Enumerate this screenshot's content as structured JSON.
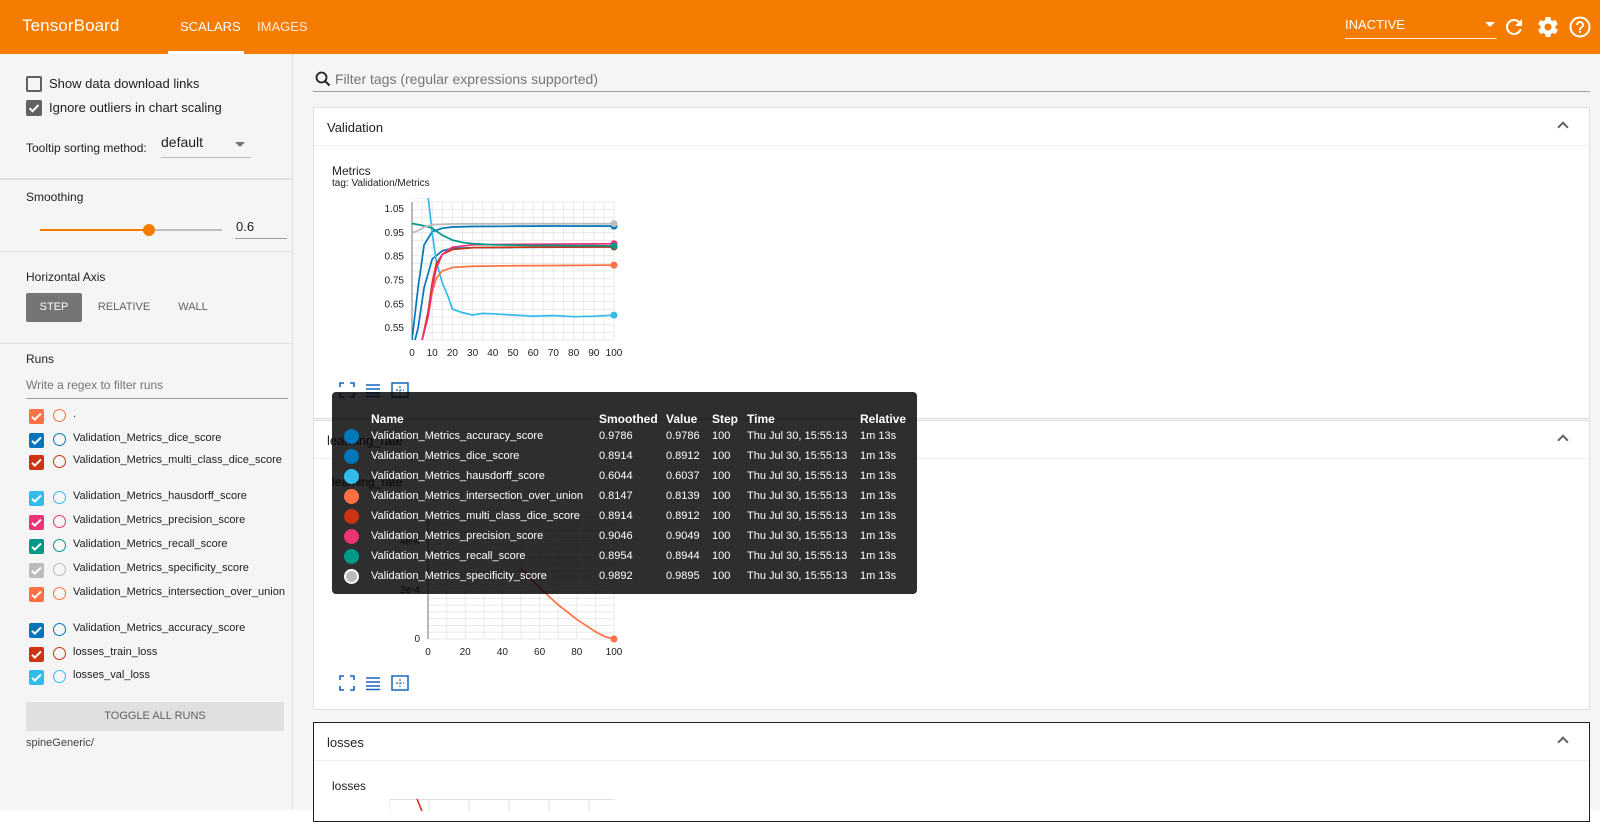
{
  "app": {
    "title": "TensorBoard",
    "tabs": [
      {
        "label": "SCALARS",
        "active": true
      },
      {
        "label": "IMAGES",
        "active": false
      }
    ],
    "run_state": "INACTIVE",
    "accent": "#f57c00"
  },
  "sidebar": {
    "show_download_links": {
      "label": "Show data download links",
      "checked": false
    },
    "ignore_outliers": {
      "label": "Ignore outliers in chart scaling",
      "checked": true
    },
    "tooltip_sorting": {
      "label": "Tooltip sorting method:",
      "value": "default"
    },
    "smoothing": {
      "label": "Smoothing",
      "value": "0.6",
      "level": 0.6
    },
    "horizontal_axis": {
      "label": "Horizontal Axis",
      "options": [
        "STEP",
        "RELATIVE",
        "WALL"
      ],
      "selected": "STEP"
    },
    "runs": {
      "label": "Runs",
      "filter_placeholder": "Write a regex to filter runs",
      "items": [
        {
          "name": ".",
          "color": "#ff7043",
          "checked": true
        },
        {
          "name": "Validation_Metrics_dice_score",
          "color": "#0077bb",
          "checked": true
        },
        {
          "name": "Validation_Metrics_multi_class_dice_score",
          "color": "#cc3311",
          "checked": true
        },
        {
          "name": "Validation_Metrics_hausdorff_score",
          "color": "#33bbee",
          "checked": true
        },
        {
          "name": "Validation_Metrics_precision_score",
          "color": "#ee3377",
          "checked": true
        },
        {
          "name": "Validation_Metrics_recall_score",
          "color": "#009988",
          "checked": true
        },
        {
          "name": "Validation_Metrics_specificity_score",
          "color": "#bbbbbb",
          "checked": true
        },
        {
          "name": "Validation_Metrics_intersection_over_union",
          "color": "#ff7043",
          "checked": true
        },
        {
          "name": "Validation_Metrics_accuracy_score",
          "color": "#0077bb",
          "checked": true
        },
        {
          "name": "losses_train_loss",
          "color": "#cc3311",
          "checked": true
        },
        {
          "name": "losses_val_loss",
          "color": "#33bbee",
          "checked": true
        }
      ],
      "toggle_all_label": "TOGGLE ALL RUNS",
      "logdir": "spineGeneric/"
    }
  },
  "main": {
    "filter_placeholder": "Filter tags (regular expressions supported)",
    "cards": {
      "validation": {
        "title": "Validation",
        "chart": {
          "title": "Metrics",
          "tag": "tag: Validation/Metrics"
        }
      },
      "learning_rate": {
        "title": "learning_rate",
        "chart": {
          "title": "learning_rate"
        }
      },
      "losses": {
        "title": "losses",
        "chart": {
          "title": "losses"
        }
      }
    }
  },
  "chart_data": [
    {
      "type": "line",
      "title": "Metrics",
      "xlabel": "",
      "ylabel": "",
      "xlim": [
        0,
        100
      ],
      "ylim": [
        0.5,
        1.08
      ],
      "x_ticks": [
        "0",
        "10",
        "20",
        "30",
        "40",
        "50",
        "60",
        "70",
        "80",
        "90",
        "100"
      ],
      "y_ticks": [
        "1.05",
        "0.95",
        "0.85",
        "0.75",
        "0.65",
        "0.55"
      ],
      "grid": true,
      "series": [
        {
          "name": "Validation_Metrics_accuracy_score",
          "color": "#0077bb",
          "x": [
            0,
            3,
            6,
            10,
            15,
            20,
            30,
            50,
            70,
            100
          ],
          "values": [
            0.5,
            0.72,
            0.9,
            0.955,
            0.97,
            0.975,
            0.977,
            0.978,
            0.979,
            0.9786
          ]
        },
        {
          "name": "Validation_Metrics_dice_score",
          "color": "#0077bb",
          "x": [
            0,
            3,
            6,
            10,
            15,
            20,
            30,
            50,
            70,
            100
          ],
          "values": [
            0.45,
            0.55,
            0.72,
            0.84,
            0.875,
            0.885,
            0.888,
            0.889,
            0.89,
            0.8914
          ]
        },
        {
          "name": "Validation_Metrics_hausdorff_score",
          "color": "#33bbee",
          "x": [
            0,
            5,
            8,
            10,
            12,
            15,
            18,
            20,
            25,
            30,
            35,
            40,
            50,
            60,
            70,
            80,
            90,
            100
          ],
          "values": [
            1.1,
            1.1,
            1.1,
            0.95,
            0.83,
            0.74,
            0.68,
            0.63,
            0.615,
            0.605,
            0.612,
            0.61,
            0.605,
            0.6,
            0.603,
            0.598,
            0.6,
            0.6044
          ]
        },
        {
          "name": "Validation_Metrics_intersection_over_union",
          "color": "#ff7043",
          "x": [
            0,
            5,
            8,
            10,
            12,
            15,
            20,
            30,
            50,
            70,
            100
          ],
          "values": [
            0.45,
            0.5,
            0.6,
            0.7,
            0.76,
            0.79,
            0.805,
            0.81,
            0.812,
            0.813,
            0.8147
          ]
        },
        {
          "name": "Validation_Metrics_multi_class_dice_score",
          "color": "#cc3311",
          "x": [
            0,
            5,
            8,
            10,
            12,
            15,
            20,
            30,
            50,
            70,
            100
          ],
          "values": [
            0.45,
            0.5,
            0.62,
            0.74,
            0.82,
            0.86,
            0.88,
            0.888,
            0.89,
            0.891,
            0.8914
          ]
        },
        {
          "name": "Validation_Metrics_precision_score",
          "color": "#ee3377",
          "x": [
            0,
            5,
            8,
            10,
            12,
            15,
            20,
            30,
            50,
            70,
            100
          ],
          "values": [
            0.45,
            0.5,
            0.6,
            0.72,
            0.8,
            0.86,
            0.89,
            0.9,
            0.902,
            0.903,
            0.9046
          ]
        },
        {
          "name": "Validation_Metrics_recall_score",
          "color": "#009988",
          "x": [
            0,
            3,
            6,
            10,
            15,
            20,
            25,
            30,
            40,
            50,
            60,
            70,
            80,
            90,
            100
          ],
          "values": [
            0.99,
            0.985,
            0.98,
            0.97,
            0.94,
            0.92,
            0.91,
            0.905,
            0.9,
            0.899,
            0.897,
            0.898,
            0.896,
            0.897,
            0.8954
          ]
        },
        {
          "name": "Validation_Metrics_specificity_score",
          "color": "#bbbbbb",
          "x": [
            0,
            3,
            6,
            10,
            20,
            50,
            100
          ],
          "values": [
            0.95,
            0.96,
            0.975,
            0.985,
            0.988,
            0.989,
            0.9892
          ]
        }
      ]
    },
    {
      "type": "line",
      "title": "learning_rate",
      "xlabel": "",
      "ylabel": "",
      "xlim": [
        0,
        100
      ],
      "ylim": [
        0,
        0.0005
      ],
      "x_ticks": [
        "0",
        "20",
        "40",
        "60",
        "80",
        "100"
      ],
      "y_ticks": [
        "4e-4",
        "2e-4",
        "0"
      ],
      "grid": true,
      "series": [
        {
          "name": ".",
          "color": "#ff7043",
          "x": [
            50,
            60,
            70,
            80,
            90,
            95,
            100
          ],
          "values": [
            0.00029,
            0.00021,
            0.00014,
            8e-05,
            3e-05,
            1e-05,
            0.0
          ]
        }
      ]
    }
  ],
  "tooltip": {
    "headers": {
      "name": "Name",
      "smoothed": "Smoothed",
      "value": "Value",
      "step": "Step",
      "time": "Time",
      "relative": "Relative"
    },
    "rows": [
      {
        "color": "#0077bb",
        "name": "Validation_Metrics_accuracy_score",
        "smoothed": "0.9786",
        "value": "0.9786",
        "step": "100",
        "time": "Thu Jul 30, 15:55:13",
        "relative": "1m 13s"
      },
      {
        "color": "#0077bb",
        "name": "Validation_Metrics_dice_score",
        "smoothed": "0.8914",
        "value": "0.8912",
        "step": "100",
        "time": "Thu Jul 30, 15:55:13",
        "relative": "1m 13s"
      },
      {
        "color": "#33bbee",
        "name": "Validation_Metrics_hausdorff_score",
        "smoothed": "0.6044",
        "value": "0.6037",
        "step": "100",
        "time": "Thu Jul 30, 15:55:13",
        "relative": "1m 13s"
      },
      {
        "color": "#ff7043",
        "name": "Validation_Metrics_intersection_over_union",
        "smoothed": "0.8147",
        "value": "0.8139",
        "step": "100",
        "time": "Thu Jul 30, 15:55:13",
        "relative": "1m 13s"
      },
      {
        "color": "#cc3311",
        "name": "Validation_Metrics_multi_class_dice_score",
        "smoothed": "0.8914",
        "value": "0.8912",
        "step": "100",
        "time": "Thu Jul 30, 15:55:13",
        "relative": "1m 13s"
      },
      {
        "color": "#ee3377",
        "name": "Validation_Metrics_precision_score",
        "smoothed": "0.9046",
        "value": "0.9049",
        "step": "100",
        "time": "Thu Jul 30, 15:55:13",
        "relative": "1m 13s"
      },
      {
        "color": "#009988",
        "name": "Validation_Metrics_recall_score",
        "smoothed": "0.8954",
        "value": "0.8944",
        "step": "100",
        "time": "Thu Jul 30, 15:55:13",
        "relative": "1m 13s"
      },
      {
        "color": "#bbbbbb",
        "name": "Validation_Metrics_specificity_score",
        "smoothed": "0.9892",
        "value": "0.9895",
        "step": "100",
        "time": "Thu Jul 30, 15:55:13",
        "relative": "1m 13s"
      }
    ]
  }
}
